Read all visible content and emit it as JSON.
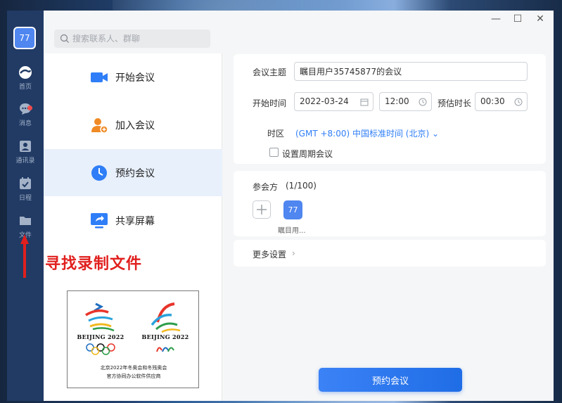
{
  "window": {
    "controls": {
      "minimize": "—",
      "maximize": "☐",
      "close": "✕"
    }
  },
  "user": {
    "avatar_text": "77"
  },
  "nav": {
    "items": [
      {
        "label": "首页",
        "icon": "home-icon"
      },
      {
        "label": "消息",
        "icon": "chat-bubble-icon",
        "has_badge": true
      },
      {
        "label": "通讯录",
        "icon": "contacts-icon"
      },
      {
        "label": "日程",
        "icon": "calendar-check-icon"
      },
      {
        "label": "文件",
        "icon": "folder-icon"
      }
    ]
  },
  "search": {
    "placeholder": "搜索联系人、群聊"
  },
  "actions": [
    {
      "label": "开始会议",
      "icon": "video-camera-icon"
    },
    {
      "label": "加入会议",
      "icon": "person-add-icon"
    },
    {
      "label": "预约会议",
      "icon": "clock-icon",
      "selected": true
    },
    {
      "label": "共享屏幕",
      "icon": "screen-share-icon"
    }
  ],
  "annotation": {
    "text": "寻找录制文件"
  },
  "sponsor": {
    "logo_left_text": "BEIJING 2022",
    "logo_right_text": "BEIJING 2022",
    "line1": "北京2022年冬奥会和冬残奥会",
    "line2": "官方协同办公软件供应商"
  },
  "form": {
    "topic_label": "会议主题",
    "topic_value": "瞩目用户35745877的会议",
    "start_label": "开始时间",
    "date_value": "2022-03-24",
    "time_value": "12:00",
    "duration_label": "预估时长",
    "duration_value": "00:30",
    "timezone_label": "时区",
    "timezone_value": "(GMT +8:00) 中国标准时间 (北京)",
    "recurring_label": "设置周期会议",
    "recurring_checked": false
  },
  "attendees": {
    "label": "参会方",
    "count": "(1/100)",
    "items": [
      {
        "avatar_text": "77",
        "name": "瞩目用..."
      }
    ]
  },
  "more_settings": {
    "label": "更多设置"
  },
  "submit": {
    "label": "预约会议"
  },
  "colors": {
    "accent": "#2f7ef7",
    "nav_bg": "#213b65",
    "annotation": "#e0201e"
  }
}
